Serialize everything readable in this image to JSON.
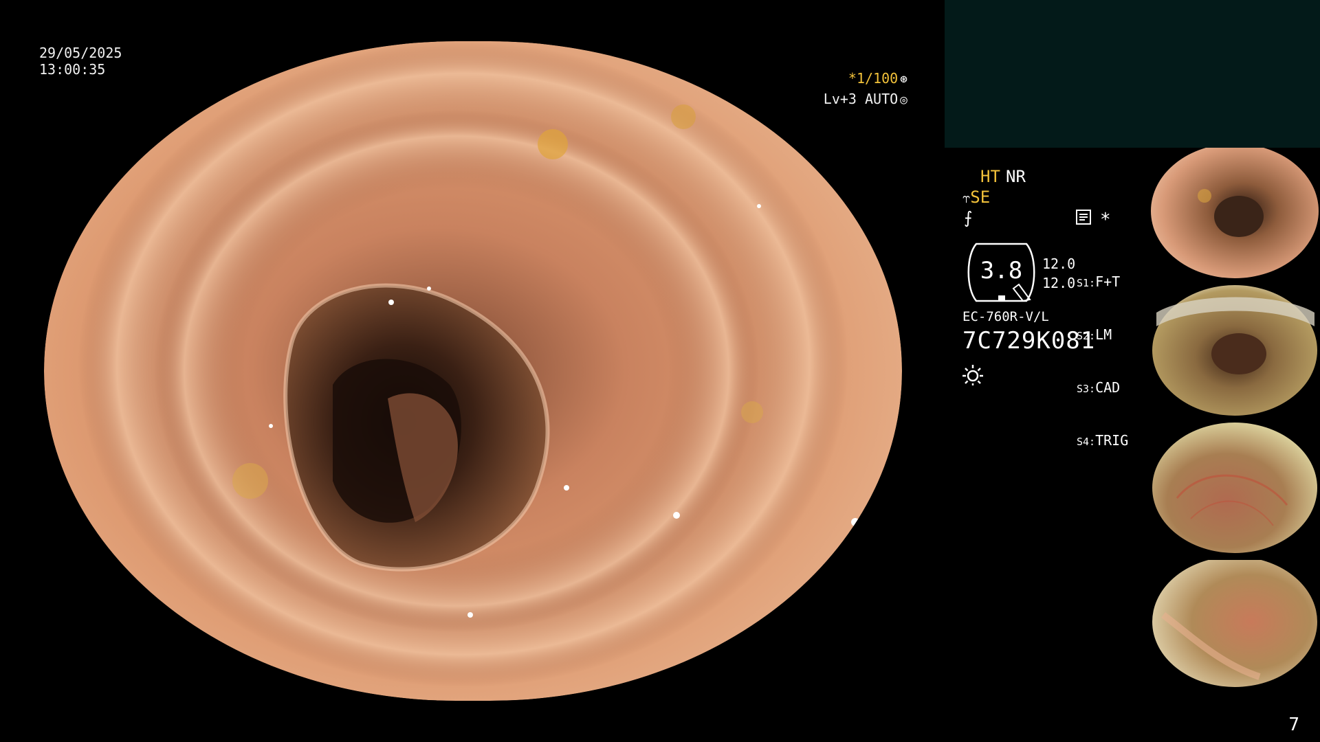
{
  "overlay": {
    "date": "29/05/2025",
    "time": "13:00:35",
    "shutter": "*1/100",
    "shutter_icon": "aperture-icon",
    "light": "Lv+3 AUTO",
    "light_icon": "iris-icon"
  },
  "panel": {
    "ht": "HT",
    "nr": "NR",
    "se": "SE",
    "se_icon": "structure-enhance-icon",
    "f_icon": "f-curve-icon",
    "memo_icon": "memo-icon",
    "star": "*",
    "gauge_value": "3.8",
    "level_1": "12.0",
    "level_2": "12.0",
    "switches": [
      {
        "key": "S1:",
        "value": "F+T"
      },
      {
        "key": "S2:",
        "value": "LM"
      },
      {
        "key": "S3:",
        "value": "CAD"
      },
      {
        "key": "S4:",
        "value": "TRIG"
      }
    ],
    "model": "EC-760R-V/L",
    "serial": "7C729K081",
    "lamp_icon": "sun-icon"
  },
  "page_number": "7",
  "colors": {
    "info_box": "#031a19",
    "accent_yellow": "#f3c23a",
    "mucosa": "#d58a63",
    "lumen": "#2a1610"
  }
}
